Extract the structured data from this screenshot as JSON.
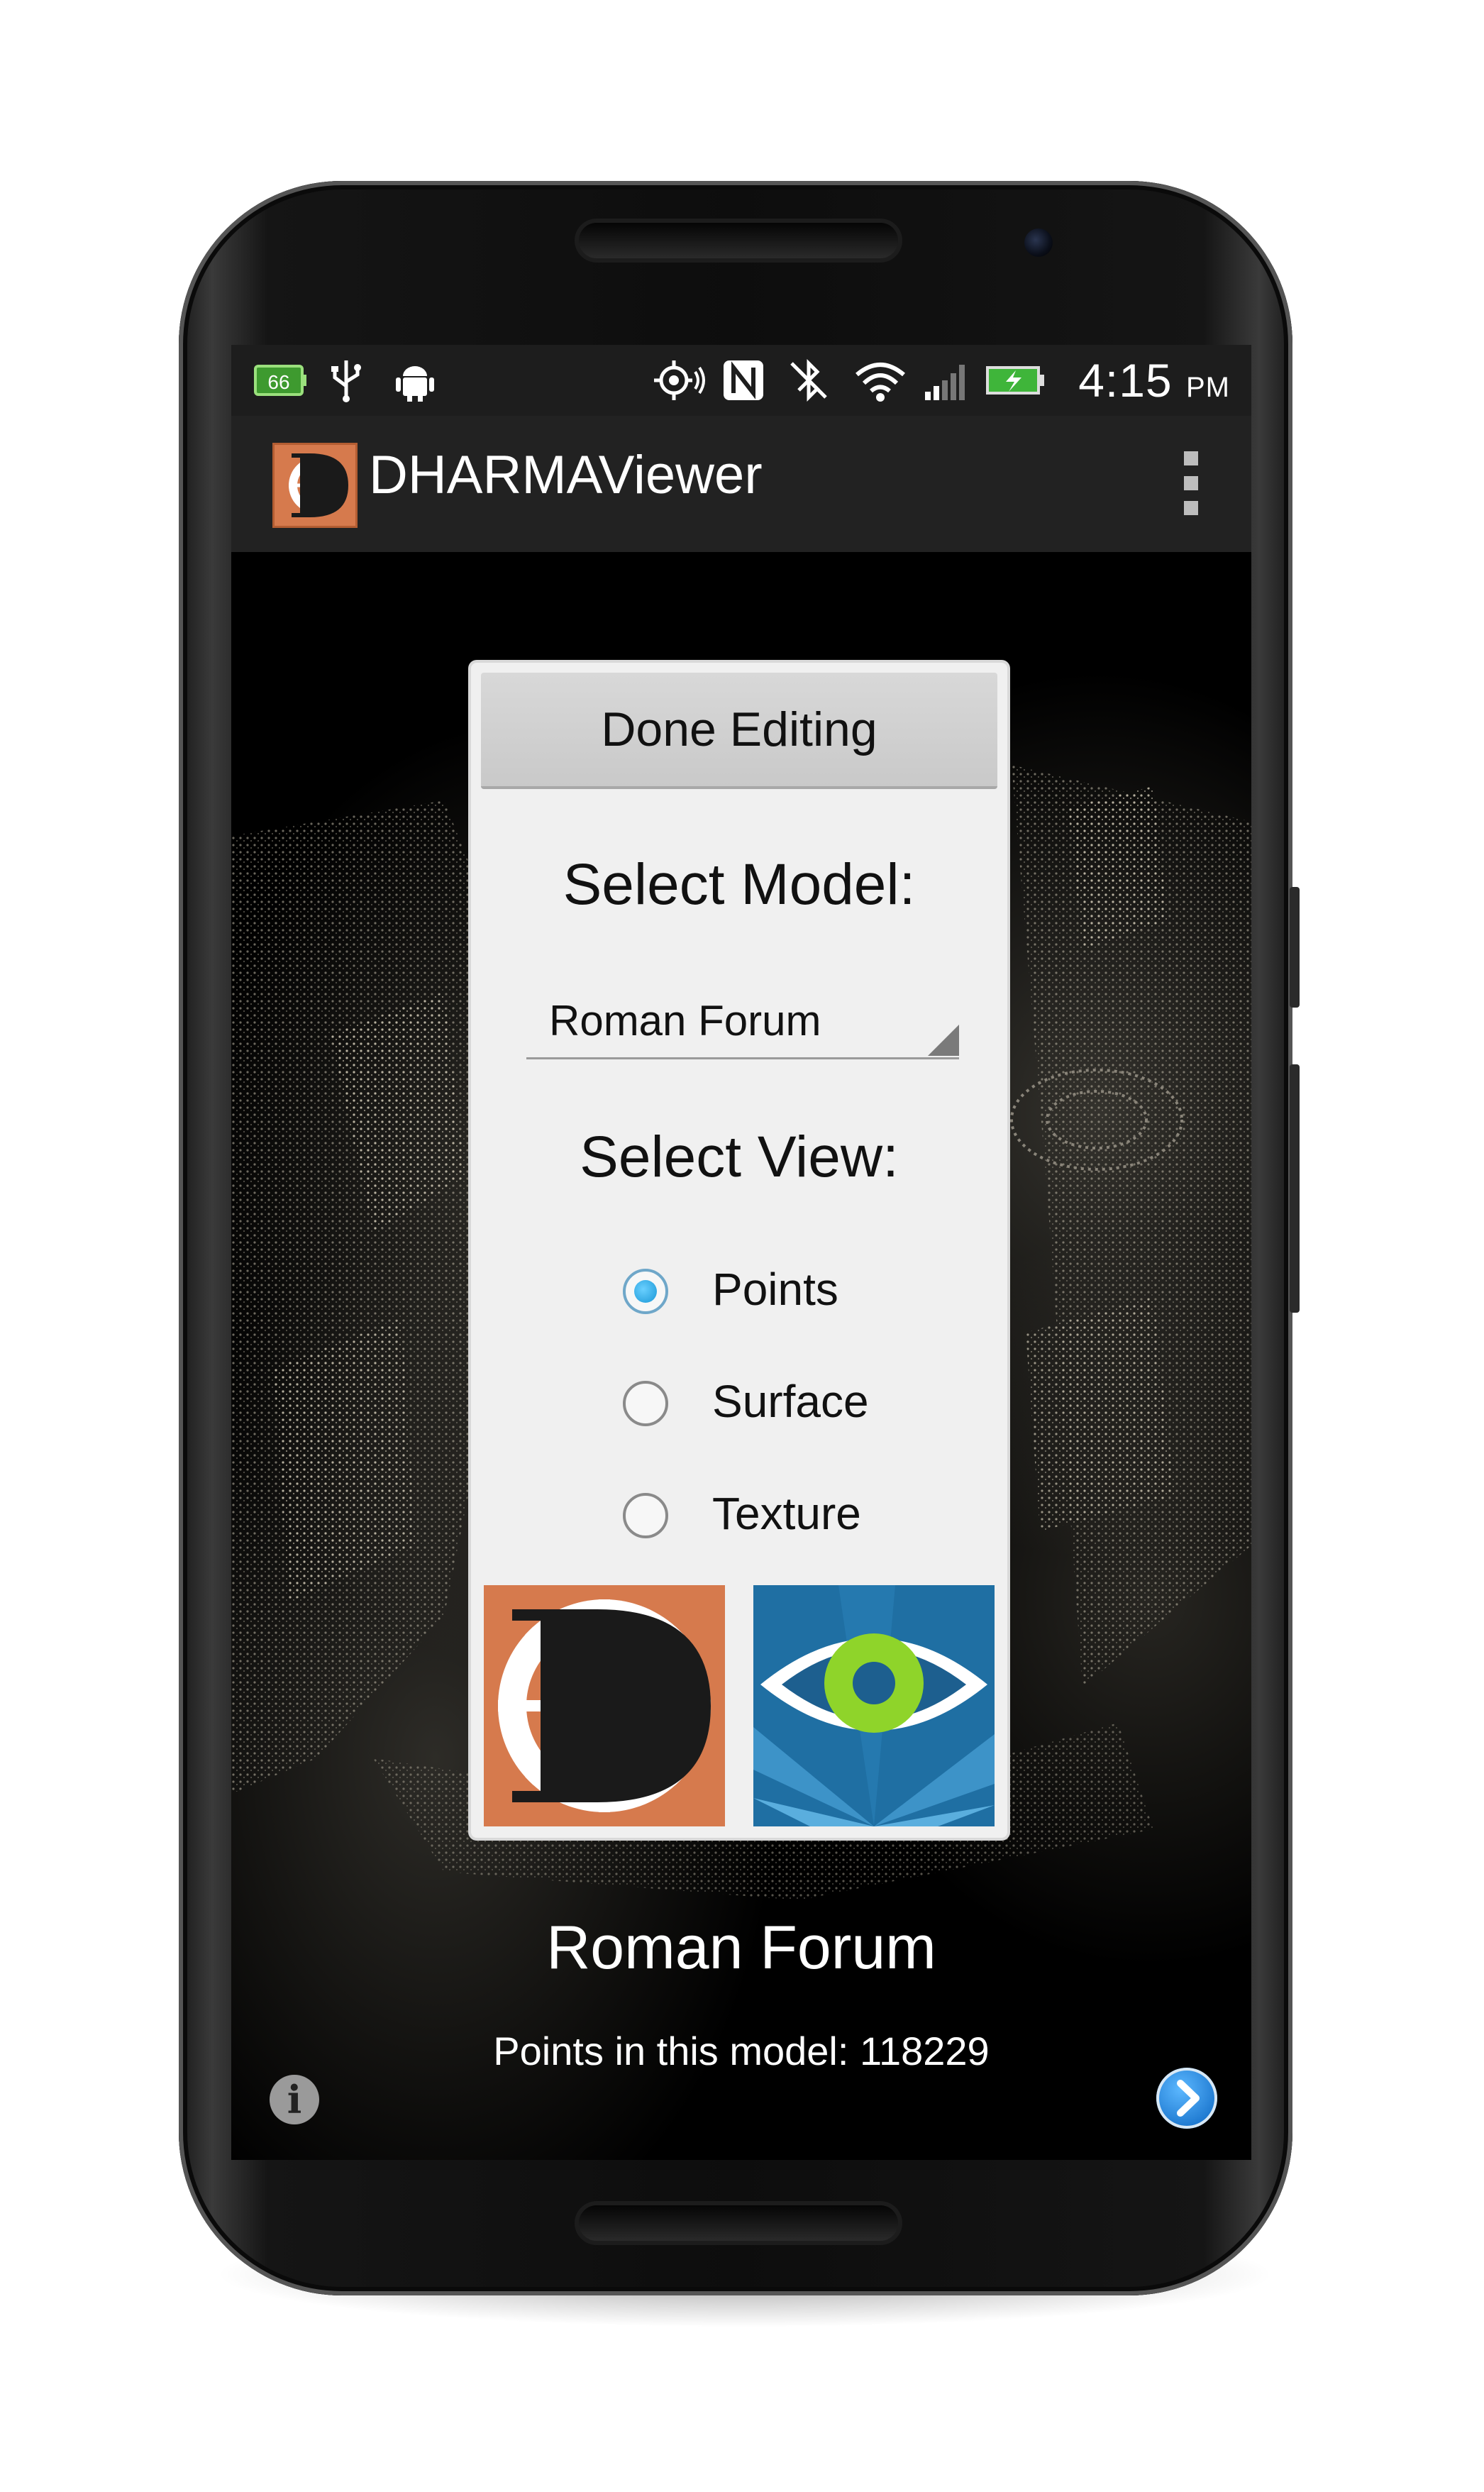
{
  "status_bar": {
    "battery_saver_badge": "66",
    "time": "4:15",
    "time_suffix": "PM",
    "icons": [
      "battery-badge-icon",
      "usb-icon",
      "android-debug-icon",
      "gps-icon",
      "nfc-icon",
      "bluetooth-muted-icon",
      "wifi-icon",
      "signal-icon",
      "battery-charging-icon"
    ]
  },
  "action_bar": {
    "app_title": "DHARMAViewer",
    "logo_icon": "dharma-logo-icon",
    "overflow_icon": "overflow-menu-icon"
  },
  "dialog": {
    "done_button": "Done Editing",
    "select_model_heading": "Select Model:",
    "model_spinner_value": "Roman Forum",
    "select_view_heading": "Select View:",
    "view_options": [
      {
        "label": "Points",
        "checked": true
      },
      {
        "label": "Surface",
        "checked": false
      },
      {
        "label": "Texture",
        "checked": false
      }
    ]
  },
  "footer": {
    "model_name": "Roman Forum",
    "points_text": "Points in this model: 118229",
    "info_glyph": "i"
  },
  "colors": {
    "accent": "#1a97d6",
    "logo_orange": "#d67a4d",
    "eye_green": "#8fd42a"
  }
}
